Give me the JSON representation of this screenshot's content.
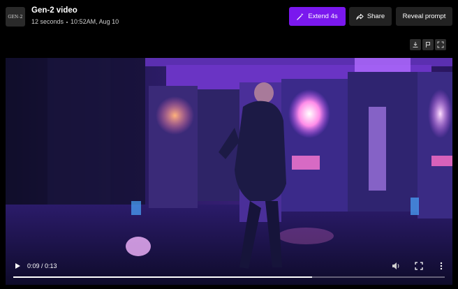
{
  "header": {
    "thumbnail_text": "GEN-2",
    "title": "Gen-2 video",
    "duration": "12 seconds",
    "timestamp": "10:52AM, Aug 10"
  },
  "actions": {
    "extend_label": "Extend 4s",
    "share_label": "Share",
    "reveal_label": "Reveal prompt",
    "accent_color": "#7a18ee"
  },
  "tools": {
    "icons": [
      "download-icon",
      "flag-icon",
      "fullscreen-icon"
    ]
  },
  "player": {
    "current_time": "0:09",
    "total_time": "0:13",
    "time_display": "0:09 / 0:13",
    "progress_fraction": 0.692,
    "icons": [
      "play-icon",
      "volume-icon",
      "fullscreen-icon",
      "more-options-icon"
    ]
  },
  "video": {
    "description_icon": "video-frame"
  }
}
